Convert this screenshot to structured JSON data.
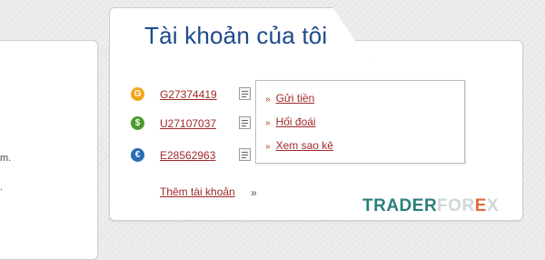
{
  "left_panel": {
    "text_1": "m.",
    "text_2": "."
  },
  "card": {
    "title": "Tài khoản của tôi"
  },
  "accounts": [
    {
      "id": "G27374419",
      "coin_symbol": "G",
      "coin_color": "#f2a51a"
    },
    {
      "id": "U27107037",
      "coin_symbol": "$",
      "coin_color": "#4a9a2c"
    },
    {
      "id": "E28562963",
      "coin_symbol": "€",
      "coin_color": "#2a6eb5"
    }
  ],
  "menu": {
    "items": [
      "Gửi tiền",
      "Hối đoái",
      "Xem sao kê"
    ],
    "arrow": "»"
  },
  "add_account": {
    "label": "Thêm tài khoản",
    "suffix": "»"
  },
  "watermark": {
    "part1": "TRADER",
    "part2": "FOR",
    "part3": "E",
    "part4": "X"
  },
  "colors": {
    "link": "#a02a2a",
    "title": "#1e4a8a",
    "watermark_primary": "#2a7f7a",
    "watermark_faded": "#cfd8d8",
    "watermark_accent": "#e2693c"
  }
}
